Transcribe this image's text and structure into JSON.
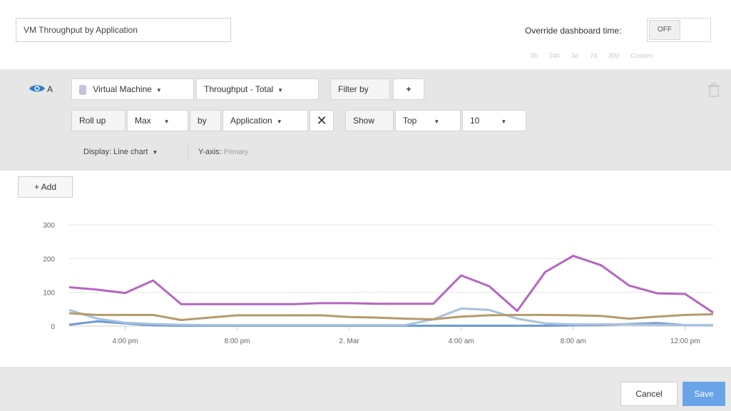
{
  "editor": {
    "title_value": "VM Throughput by Application",
    "override_label": "Override dashboard time:",
    "override_toggle": "OFF",
    "time_ranges": [
      "3h",
      "24h",
      "3d",
      "7d",
      "30d",
      "Custom"
    ]
  },
  "query": {
    "letter": "A",
    "object_type": "Virtual Machine",
    "metric": "Throughput - Total",
    "filter_label": "Filter by",
    "add_filter": "+",
    "rollup_label": "Roll up",
    "rollup_func": "Max",
    "by_label": "by",
    "group_by": "Application",
    "remove_group": "✕",
    "show_label": "Show",
    "show_mode": "Top",
    "show_count": "10",
    "display": "Display: Line chart",
    "yaxis_label": "Y-axis:",
    "yaxis_value": "Primary"
  },
  "add_button": "+ Add",
  "footer": {
    "cancel": "Cancel",
    "save": "Save"
  },
  "colors": {
    "purple": "#b565c2",
    "tan": "#b79a6b",
    "lightblue": "#a6c2dc",
    "blue": "#6c9bd1",
    "save": "#6aa4e8",
    "eye": "#2f7fc8"
  },
  "chart_data": {
    "type": "line",
    "x": [
      "2:00 pm",
      "3:00 pm",
      "4:00 pm",
      "5:00 pm",
      "6:00 pm",
      "7:00 pm",
      "8:00 pm",
      "9:00 pm",
      "10:00 pm",
      "11:00 pm",
      "0:00 am",
      "1:00 am",
      "2:00 am",
      "3:00 am",
      "4:00 am",
      "5:00 am",
      "6:00 am",
      "7:00 am",
      "8:00 am",
      "9:00 am",
      "10:00 am",
      "11:00 am",
      "12:00 pm",
      "1:00 pm"
    ],
    "xlabel_ticks": [
      "4:00 pm",
      "8:00 pm",
      "2. Mar",
      "4:00 am",
      "8:00 am",
      "12:00 pm"
    ],
    "ylim": [
      0,
      300
    ],
    "yticks": [
      0,
      100,
      200,
      300
    ],
    "series": [
      {
        "color": "#b565c2",
        "values": [
          115,
          108,
          98,
          135,
          65,
          65,
          65,
          65,
          65,
          68,
          68,
          66,
          66,
          66,
          150,
          118,
          45,
          160,
          208,
          180,
          120,
          97,
          95,
          40
        ]
      },
      {
        "color": "#b79a6b",
        "values": [
          38,
          33,
          33,
          33,
          18,
          25,
          32,
          32,
          32,
          32,
          27,
          25,
          22,
          20,
          28,
          32,
          33,
          33,
          32,
          30,
          22,
          28,
          33,
          35
        ]
      },
      {
        "color": "#a6c2dc",
        "values": [
          48,
          22,
          10,
          6,
          4,
          3,
          3,
          3,
          3,
          3,
          3,
          3,
          3,
          20,
          52,
          48,
          22,
          8,
          5,
          5,
          5,
          4,
          3,
          3
        ]
      },
      {
        "color": "#6c9bd1",
        "values": [
          4,
          14,
          8,
          2,
          1,
          1,
          1,
          1,
          1,
          1,
          1,
          1,
          1,
          1,
          1,
          1,
          1,
          1,
          2,
          3,
          6,
          9,
          3,
          2
        ]
      }
    ]
  }
}
